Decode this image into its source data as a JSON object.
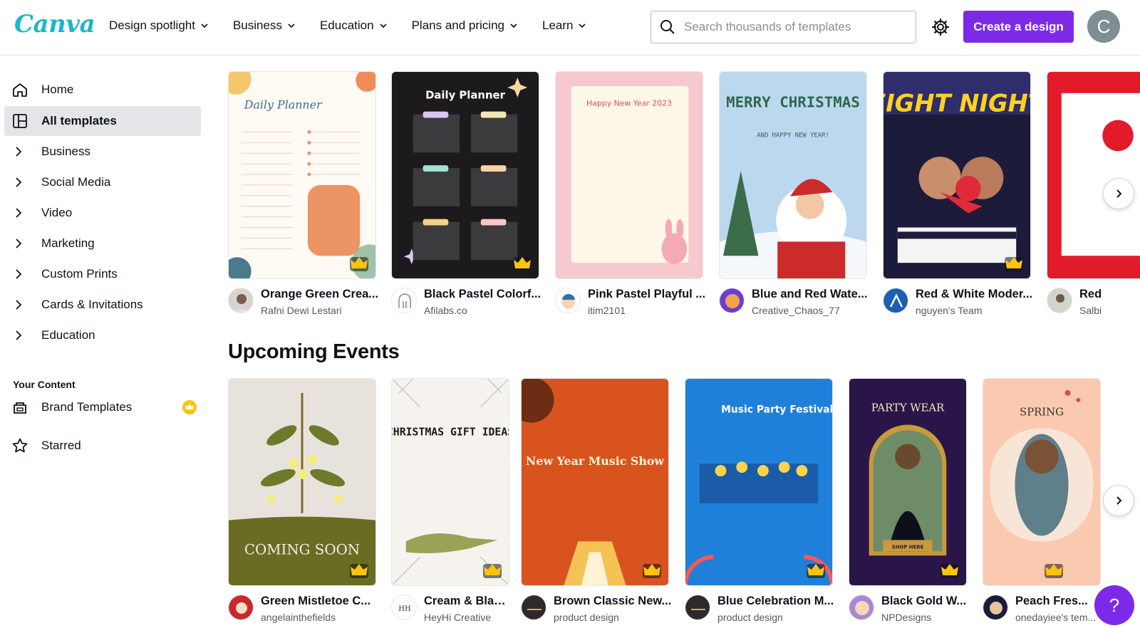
{
  "brand": {
    "logo_text": "Canva",
    "logo_color": "#1eb6c9",
    "accent": "#7d2ae8"
  },
  "nav": {
    "items": [
      {
        "label": "Design spotlight"
      },
      {
        "label": "Business"
      },
      {
        "label": "Education"
      },
      {
        "label": "Plans and pricing"
      },
      {
        "label": "Learn"
      }
    ]
  },
  "search": {
    "placeholder": "Search thousands of templates",
    "value": ""
  },
  "header": {
    "create_label": "Create a design",
    "avatar_initial": "C",
    "settings_icon": "gear-icon"
  },
  "sidebar": {
    "items": [
      {
        "label": "Home",
        "icon": "home-icon"
      },
      {
        "label": "All templates",
        "icon": "templates-icon",
        "active": true
      },
      {
        "label": "Business",
        "icon": "chevron-right-icon"
      },
      {
        "label": "Social Media",
        "icon": "chevron-right-icon"
      },
      {
        "label": "Video",
        "icon": "chevron-right-icon"
      },
      {
        "label": "Marketing",
        "icon": "chevron-right-icon"
      },
      {
        "label": "Custom Prints",
        "icon": "chevron-right-icon"
      },
      {
        "label": "Cards & Invitations",
        "icon": "chevron-right-icon"
      },
      {
        "label": "Education",
        "icon": "chevron-right-icon"
      }
    ],
    "your_content_heading": "Your Content",
    "content_items": [
      {
        "label": "Brand Templates",
        "icon": "brand-kit-icon",
        "badge": "crown-icon"
      },
      {
        "label": "Starred",
        "icon": "star-icon"
      }
    ]
  },
  "row1": {
    "cards": [
      {
        "title": "Orange Green Crea...",
        "creator": "Rafni Dewi Lestari",
        "thumb_text": "Daily Planner",
        "pro": true
      },
      {
        "title": "Black Pastel Colorf...",
        "creator": "Afilabs.co",
        "thumb_text": "Daily Planner",
        "pro": true
      },
      {
        "title": "Pink Pastel Playful ...",
        "creator": "itim2101",
        "thumb_text": "Happy New Year 2023",
        "pro": false
      },
      {
        "title": "Blue and Red Wate...",
        "creator": "Creative_Chaos_77",
        "thumb_text": "MERRY CHRISTMAS",
        "thumb_sub": "AND HAPPY NEW YEAR!",
        "pro": false
      },
      {
        "title": "Red & White Moder...",
        "creator": "nguyen's Team",
        "thumb_text": "FIGHT NIGHT",
        "pro": true
      },
      {
        "title": "Red",
        "creator": "Salbi",
        "pro": false
      }
    ]
  },
  "upcoming": {
    "title": "Upcoming Events",
    "cards": [
      {
        "title": "Green Mistletoe C...",
        "creator": "angelainthefields",
        "thumb_text": "COMING SOON",
        "pro": true
      },
      {
        "title": "Cream & Blac...",
        "creator": "HeyHi Creative",
        "thumb_text": "CHRISTMAS GIFT IDEAS",
        "pro": true
      },
      {
        "title": "Brown Classic New...",
        "creator": "product design",
        "thumb_text": "New Year Music Show",
        "pro": true
      },
      {
        "title": "Blue Celebration M...",
        "creator": "product design",
        "thumb_text": "Music Party Festival",
        "pro": true
      },
      {
        "title": "Black Gold W...",
        "creator": "NPDesigns",
        "thumb_text": "PARTY WEAR",
        "thumb_sub": "SHOP HERE",
        "pro": true
      },
      {
        "title": "Peach Fres...",
        "creator": "onedayiee's tem...",
        "thumb_text": "SPRING",
        "pro": true
      }
    ]
  },
  "help": {
    "label": "?"
  }
}
